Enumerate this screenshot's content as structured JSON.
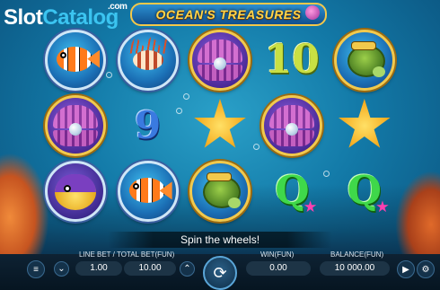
{
  "header": {
    "watermark_slot": "Slot",
    "watermark_catalog": "Catalog",
    "watermark_com": ".com",
    "game_title": "OCEAN'S TREASURES"
  },
  "reels": [
    [
      "clownfish",
      "clam-pearl",
      "pufferfish"
    ],
    [
      "lionfish",
      "9",
      "clownfish"
    ],
    [
      "clam-pearl",
      "starfish",
      "turtle"
    ],
    [
      "10",
      "clam-pearl",
      "Q"
    ],
    [
      "turtle",
      "starfish",
      "Q"
    ]
  ],
  "symbols": {
    "ten": "10",
    "nine": "9",
    "queen": "Q"
  },
  "message": "Spin the wheels!",
  "controls": {
    "line_bet_label": "LINE BET / TOTAL BET(FUN)",
    "line_bet_value": "1.00",
    "total_bet_value": "10.00",
    "win_label": "WIN(FUN)",
    "win_value": "0.00",
    "balance_label": "BALANCE(FUN)",
    "balance_value": "10 000.00"
  },
  "icons": {
    "menu": "menu-icon",
    "bet_down": "chevron-down-icon",
    "bet_up": "chevron-up-icon",
    "spin": "spin-icon",
    "autoplay": "autoplay-icon",
    "settings": "settings-icon"
  },
  "colors": {
    "title_gold": "#ffd54a",
    "ten_green": "#c9e043",
    "nine_blue": "#3a7ae0",
    "queen_green": "#3fd84a"
  }
}
